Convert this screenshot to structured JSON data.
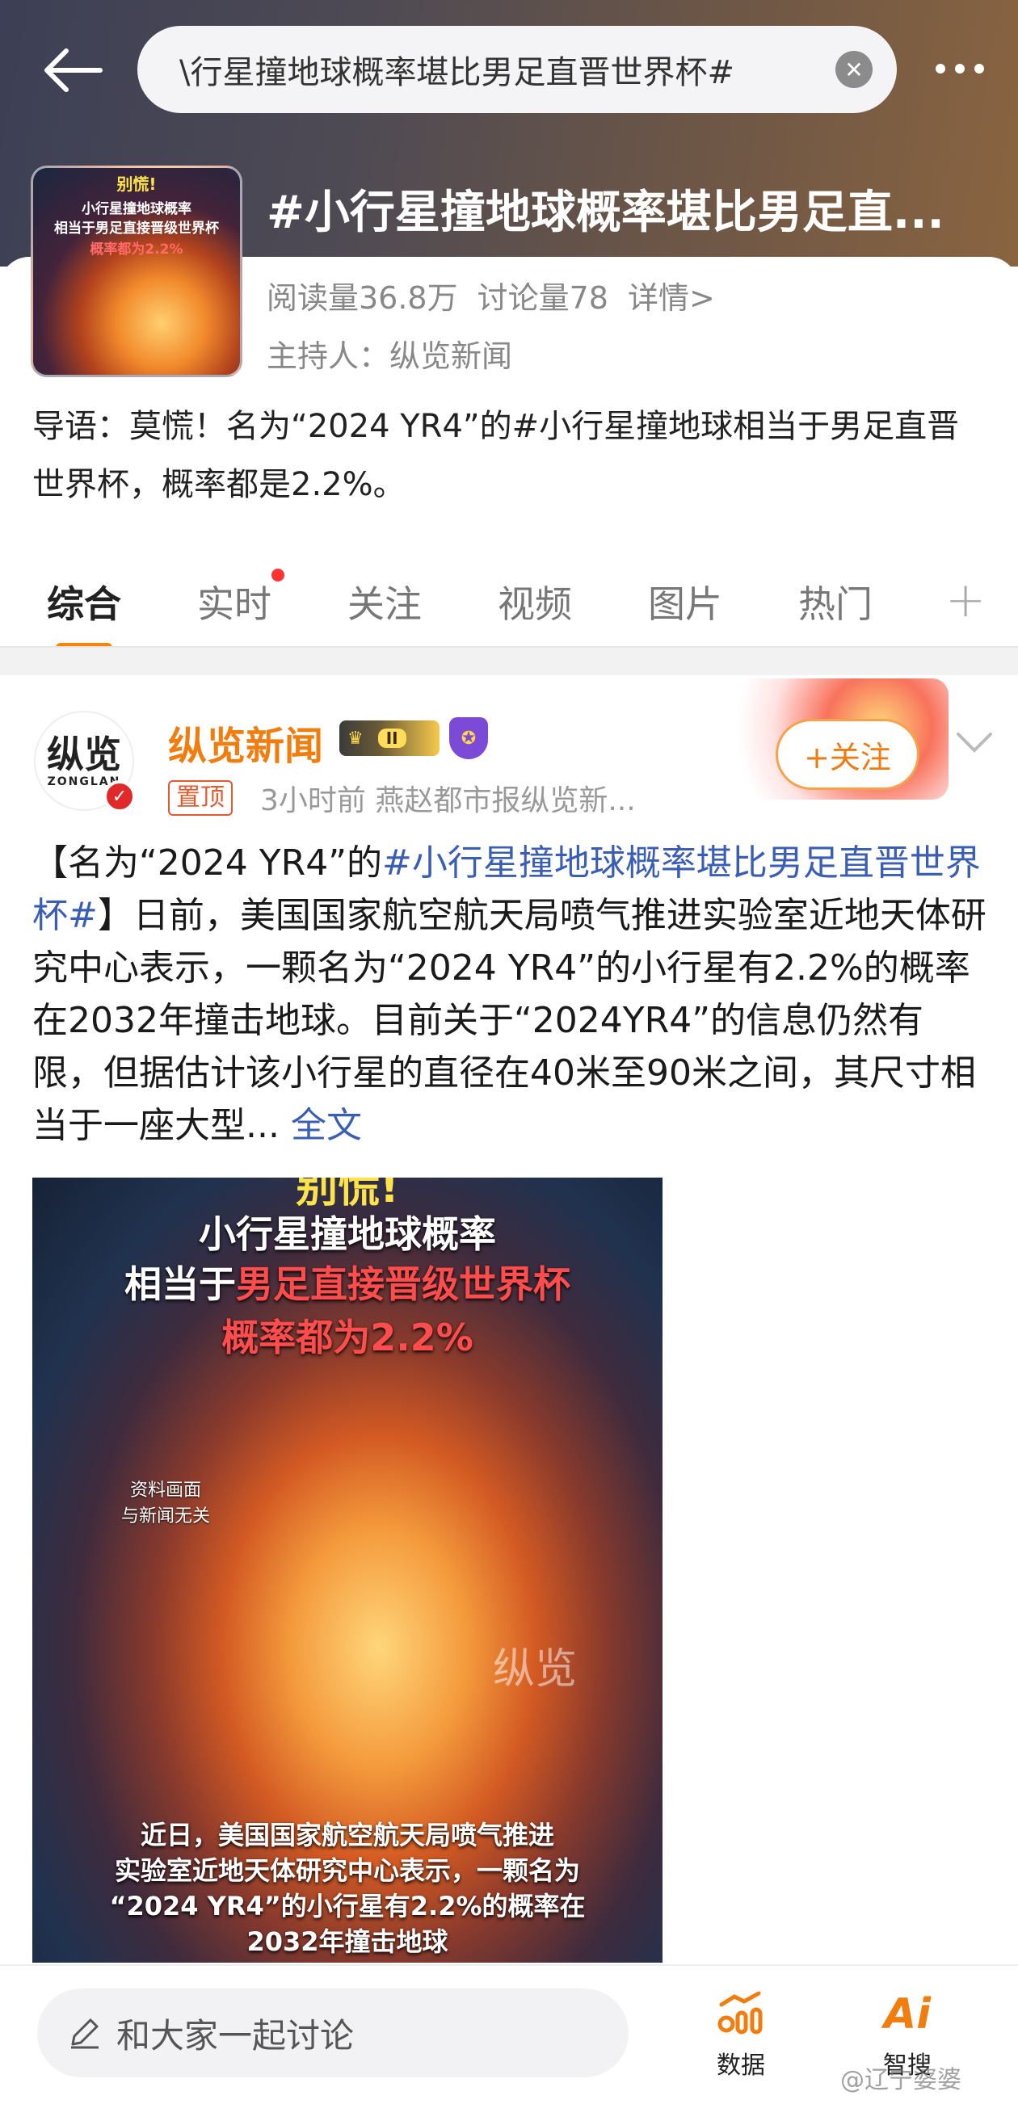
{
  "header": {
    "search_text": "\\行星撞地球概率堪比男足直晋世界杯#"
  },
  "topic": {
    "title": "#小行星撞地球概率堪比男足直...",
    "reads": "阅读量36.8万",
    "discussions": "讨论量78",
    "details": "详情>",
    "host_label": "主持人：",
    "host_name": "纵览新闻",
    "intro": "导语：莫慌！名为“2024 YR4”的#小行星撞地球相当于男足直晋世界杯，概率都是2.2%。",
    "cover": {
      "line1": "别慌!",
      "line2": "小行星撞地球概率",
      "line3": "相当于男足直接晋级世界杯",
      "line4": "概率都为2.2%"
    }
  },
  "tabs": [
    {
      "label": "综合"
    },
    {
      "label": "实时"
    },
    {
      "label": "关注"
    },
    {
      "label": "视频"
    },
    {
      "label": "图片"
    },
    {
      "label": "热门"
    }
  ],
  "tab_add": "+",
  "post": {
    "avatar_text": "纵览",
    "avatar_sub": "ZONGLAN",
    "author": "纵览新闻",
    "level_badge": "II",
    "pin_label": "置顶",
    "meta": "3小时前  燕赵都市报纵览新...",
    "follow_label": "+关注",
    "body_prefix": "【名为“2024 YR4”的",
    "body_hashtag": "#小行星撞地球概率堪比男足直晋世界杯#",
    "body_text": "】日前，美国国家航空航天局喷气推进实验室近地天体研究中心表示，一颗名为“2024 YR4”的小行星有2.2%的概率在2032年撞击地球。目前关于“2024YR4”的信息仍然有限，但据估计该小行星的直径在40米至90米之间，其尺寸相当于一座大型...",
    "full_text_link": "全文",
    "image": {
      "top_cut": "别慌!",
      "line1": "小行星撞地球概率",
      "line2_prefix": "相当于",
      "line2_red": "男足直接晋级世界杯",
      "line3": "概率都为2.2%",
      "disclaimer_1": "资料画面",
      "disclaimer_2": "与新闻无关",
      "watermark": "纵览",
      "caption_1": "近日，美国国家航空航天局喷气推进",
      "caption_2": "实验室近地天体研究中心表示，一颗名为",
      "caption_3": "“2024 YR4”的小行星有2.2%的概率在",
      "caption_4": "2032年撞击地球"
    }
  },
  "bottom_bar": {
    "comment_placeholder": "和大家一起讨论",
    "data_label": "数据",
    "ai_icon_text": "Ai",
    "ai_label": "智搜",
    "credit": "@辽宁婆婆"
  },
  "colors": {
    "accent": "#f27d0f",
    "hashtag": "#3b5eb5",
    "tab_underline": "#ff8200"
  }
}
